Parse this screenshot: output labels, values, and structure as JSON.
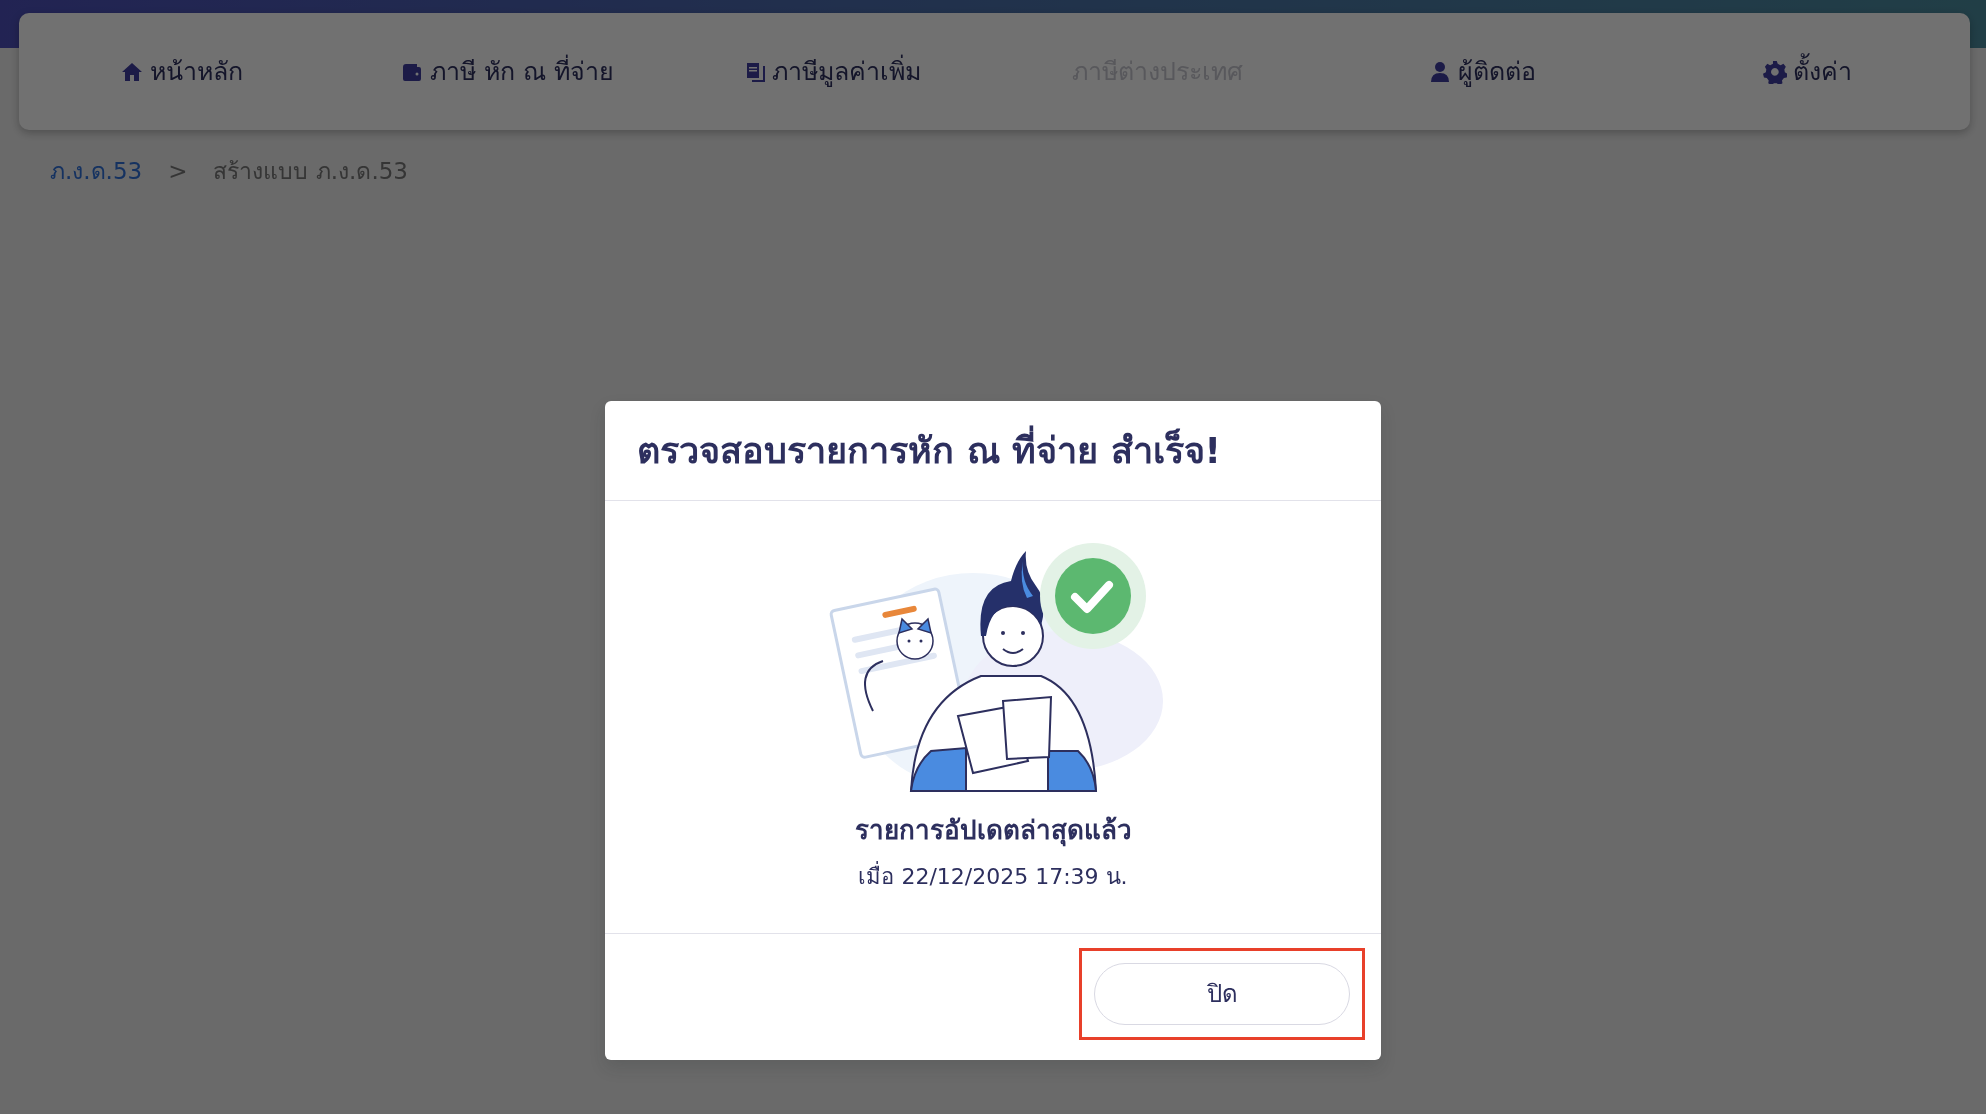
{
  "nav": {
    "items": [
      {
        "label": "หน้าหลัก",
        "disabled": false
      },
      {
        "label": "ภาษี หัก ณ ที่จ่าย",
        "disabled": false
      },
      {
        "label": "ภาษีมูลค่าเพิ่ม",
        "disabled": false
      },
      {
        "label": "ภาษีต่างประเทศ",
        "disabled": true
      },
      {
        "label": "ผู้ติดต่อ",
        "disabled": false
      },
      {
        "label": "ตั้งค่า",
        "disabled": false
      }
    ]
  },
  "breadcrumb": {
    "separator": ">",
    "items": [
      {
        "label": "ภ.ง.ด.53",
        "kind": "link"
      },
      {
        "label": "สร้างแบบ ภ.ง.ด.53",
        "kind": "current"
      }
    ]
  },
  "modal": {
    "title": "ตรวจสอบรายการหัก ณ ที่จ่าย สำเร็จ!",
    "heading": "รายการอัปเดตล่าสุดแล้ว",
    "timestamp": "เมื่อ 22/12/2025 17:39 น.",
    "buttons": [
      {
        "label": "ปิด",
        "highlighted": true
      }
    ]
  }
}
